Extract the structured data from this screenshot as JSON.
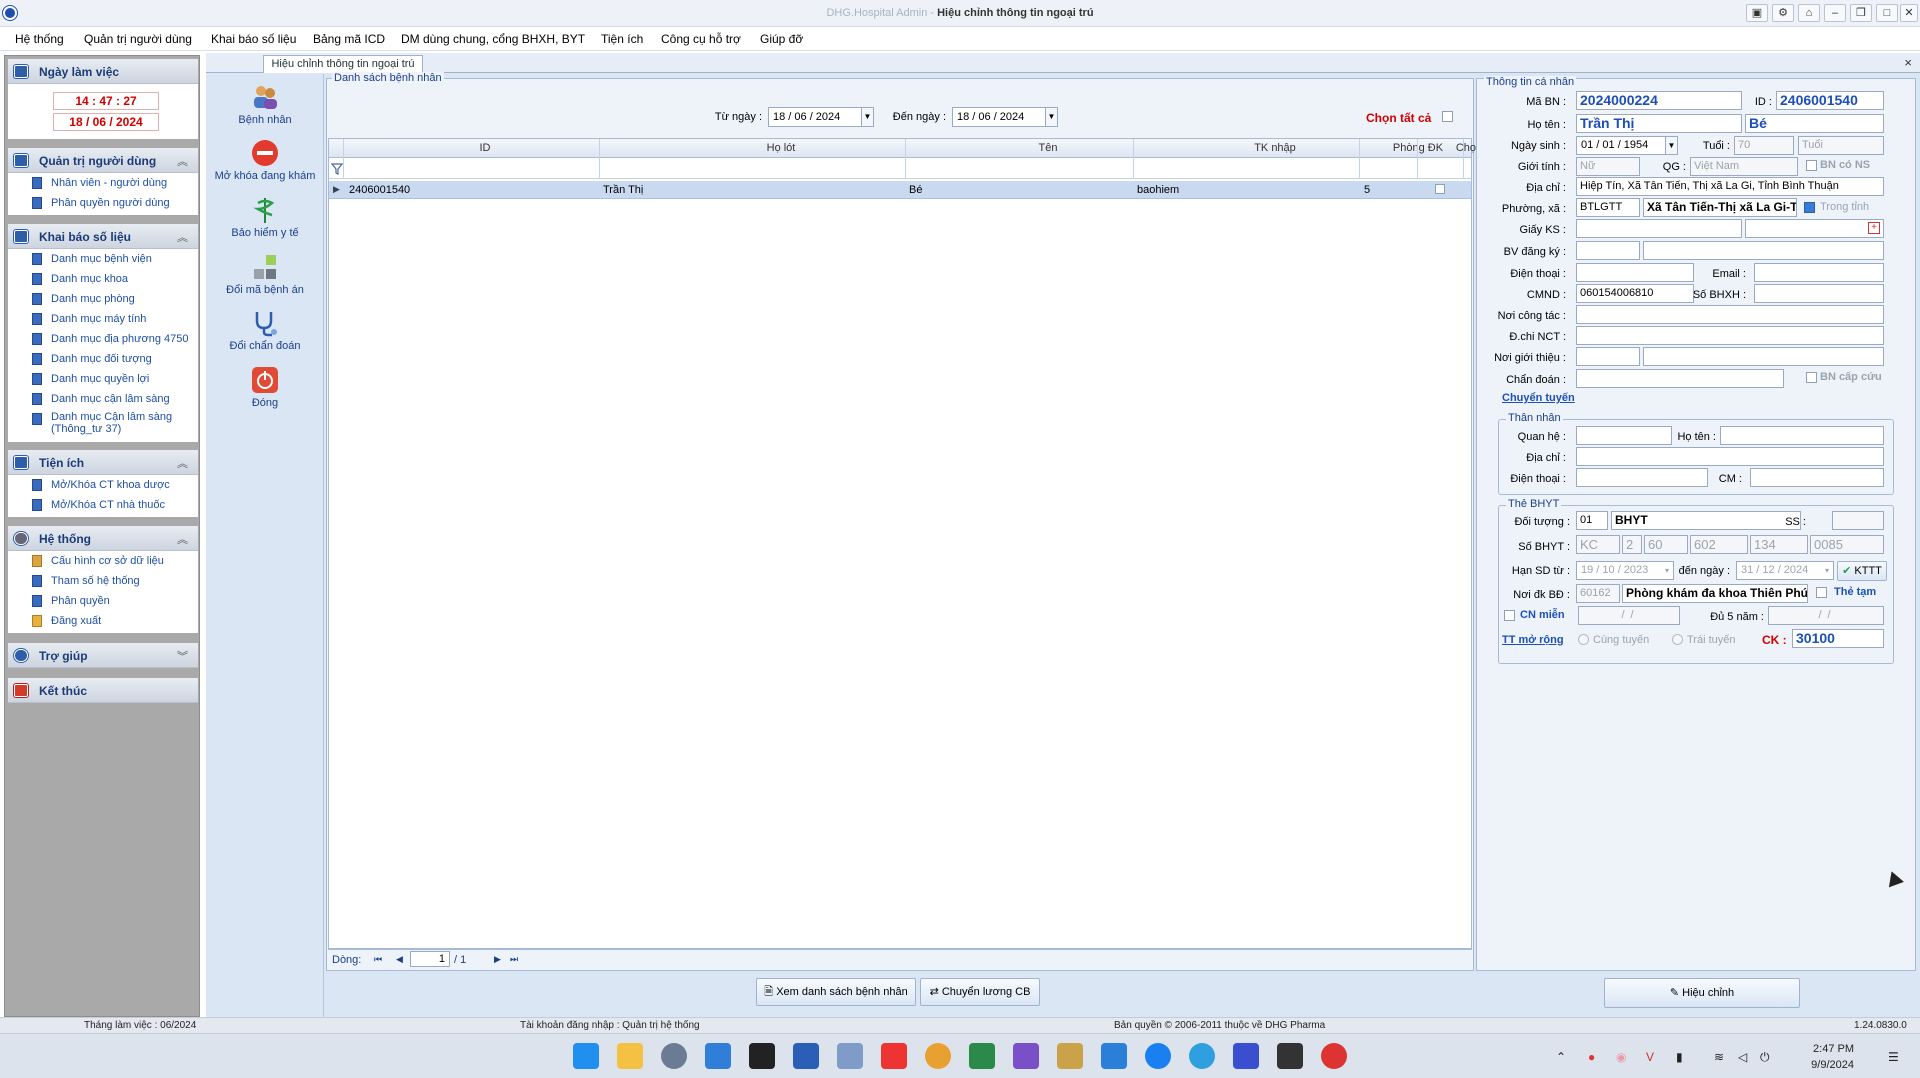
{
  "window": {
    "app_name": "DHG.Hospital Admin",
    "separator": " - ",
    "title": "Hiệu chỉnh thông tin ngoại trú"
  },
  "menu": [
    "Hệ thống",
    "Quản trị người dùng",
    "Khai báo số liệu",
    "Bảng mã ICD",
    "DM dùng chung, cổng BHXH, BYT",
    "Tiện ích",
    "Công cụ hỗ trợ",
    "Giúp đỡ"
  ],
  "sidebar": {
    "workday": {
      "title": "Ngày làm việc",
      "time": "14 : 47 : 27",
      "date": "18 / 06 / 2024"
    },
    "user_admin": {
      "title": "Quản trị người dùng",
      "items": [
        "Nhân viên - người dùng",
        "Phân quyền người dùng"
      ]
    },
    "data_decl": {
      "title": "Khai báo số liệu",
      "items": [
        "Danh mục bệnh viện",
        "Danh mục khoa",
        "Danh mục phòng",
        "Danh mục máy tính",
        "Danh mục địa phương 4750",
        "Danh mục đối tượng",
        "Danh mục quyền lợi",
        "Danh mục cận lâm sàng",
        "Danh mục Cận lâm sàng (Thông_tư 37)"
      ]
    },
    "utilities": {
      "title": "Tiện ích",
      "items": [
        "Mở/Khóa CT khoa dược",
        "Mở/Khóa CT nhà thuốc"
      ]
    },
    "system": {
      "title": "Hệ thống",
      "items": [
        "Cấu hình cơ sở dữ liệu",
        "Tham số hệ thống",
        "Phân quyền",
        "Đăng xuất"
      ]
    },
    "help": {
      "title": "Trợ giúp"
    },
    "exit": {
      "title": "Kết thúc"
    }
  },
  "tab": {
    "label": "Hiệu chỉnh thông tin ngoại trú",
    "close": "×"
  },
  "tools": [
    "Bệnh nhân",
    "Mở khóa đang khám",
    "Bảo hiểm y tế",
    "Đổi mã bệnh án",
    "Đổi chẩn đoán",
    "Đóng"
  ],
  "patients": {
    "legend": "Danh sách bệnh nhân",
    "from_label": "Từ ngày :",
    "from_value": "18 / 06 / 2024",
    "to_label": "Đến ngày :",
    "to_value": "18 / 06 / 2024",
    "select_all": "Chọn tất cả",
    "columns": [
      "ID",
      "Họ lót",
      "Tên",
      "TK nhập",
      "Phòng ĐK",
      "Chọn"
    ],
    "rows": [
      {
        "id": "2406001540",
        "ho_lot": "Trần Thị",
        "ten": "Bé",
        "tk_nhap": "baohiem",
        "phong_dk": "5"
      }
    ],
    "pager": {
      "label": "Dòng:",
      "page": "1",
      "of": "/ 1"
    },
    "btn_view": "Xem danh sách bệnh nhân",
    "btn_transfer": "Chuyển lương CB"
  },
  "info": {
    "legend": "Thông tin cá nhân",
    "ma_bn_label": "Mã BN :",
    "ma_bn": "2024000224",
    "id_label": "ID :",
    "id": "2406001540",
    "ho_ten_label": "Họ tên :",
    "ho": "Trần Thị",
    "ten": "Bé",
    "ngay_sinh_label": "Ngày sinh :",
    "ngay_sinh": "01 / 01 / 1954",
    "tuoi_label": "Tuổi :",
    "tuoi": "70",
    "tuoi_unit": "Tuổi",
    "gioi_tinh_label": "Giới tính :",
    "gioi_tinh": "Nữ",
    "qg_label": "QG :",
    "qg": "Việt Nam",
    "bn_co_ns": "BN có NS",
    "dia_chi_label": "Địa chỉ :",
    "dia_chi": "Hiệp Tín, Xã Tân Tiến, Thị xã La Gi, Tỉnh Bình Thuận",
    "phuong_xa_label": "Phường, xã :",
    "phuong_xa_code": "BTLGTT",
    "phuong_xa": "Xã Tân Tiến-Thị xã La Gi-Tỉnh Bình Thuận",
    "trong_tinh": "Trong tỉnh",
    "giay_ks_label": "Giấy KS :",
    "bv_dang_ky_label": "BV đăng ký :",
    "dien_thoai_label": "Điện thoại :",
    "email_label": "Email :",
    "cmnd_label": "CMND :",
    "cmnd": "060154006810",
    "so_bhxh_label": "Số BHXH :",
    "noi_cong_tac_label": "Nơi công tác :",
    "dchi_nct_label": "Đ.chi NCT :",
    "noi_gioi_thieu_label": "Nơi giới thiệu :",
    "chan_doan_label": "Chẩn đoán :",
    "bn_cap_cuu": "BN cấp cứu",
    "chuyen_tuyen": "Chuyển tuyến",
    "relative": {
      "legend": "Thân nhân",
      "quan_he_label": "Quan hệ :",
      "ho_ten_label": "Họ tên :",
      "dia_chi_label": "Địa chỉ :",
      "dien_thoai_label": "Điện thoại :",
      "cm_label": "CM :"
    },
    "bhyt": {
      "legend": "Thẻ BHYT",
      "doi_tuong_label": "Đối tượng :",
      "doi_tuong_code": "01",
      "doi_tuong": "BHYT",
      "ss_label": "SS :",
      "so_bhyt_label": "Số BHYT :",
      "so_bhyt": [
        "KC",
        "2",
        "60",
        "602",
        "134",
        "0085"
      ],
      "han_sd_label": "Hạn SD từ :",
      "han_tu": "19 / 10 / 2023",
      "den_ngay_label": "đến ngày :",
      "han_den": "31 / 12 / 2024",
      "kttt": "KTTT",
      "noi_dk_label": "Nơi đk BĐ :",
      "noi_dk_code": "60162",
      "noi_dk": "Phòng khám đa khoa Thiên Phúc",
      "the_tam": "Thẻ tạm",
      "cn_mien": "CN miễn",
      "du_5_nam_label": "Đủ 5 năm :",
      "tt_mo_rong": "TT mở rộng",
      "cung_tuyen": "Cùng tuyến",
      "trai_tuyen": "Trái tuyến",
      "ck_label": "CK :",
      "ck": "30100"
    },
    "btn_edit": "Hiệu chỉnh"
  },
  "status": {
    "month": "Tháng làm việc : 06/2024",
    "account": "Tài khoản đăng nhập : Quản trị hệ thống",
    "copyright": "Bản quyền © 2006-2011 thuộc về DHG Pharma",
    "version": "1.24.0830.0"
  },
  "taskbar": {
    "time": "2:47 PM",
    "date": "9/9/2024"
  },
  "colors": {
    "accent": "#1c4fb8",
    "alert": "#d10000",
    "nav_bg": "#a9a9a9",
    "panel_bg": "#dbe6f4"
  }
}
